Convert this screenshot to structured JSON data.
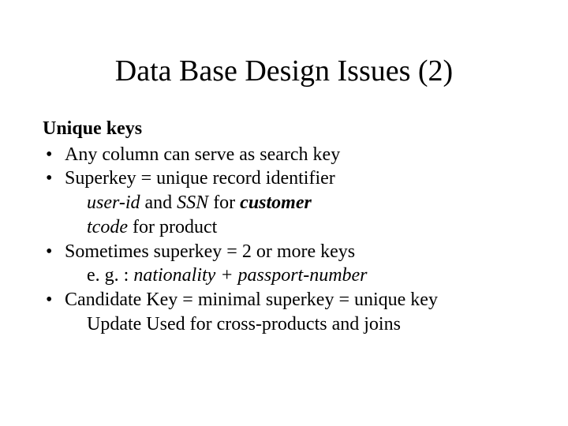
{
  "title": "Data Base Design Issues (2)",
  "section": "Unique keys",
  "items": [
    {
      "main": "Any column can serve as search key"
    },
    {
      "main": "Superkey = unique record identifier",
      "sub1_it1": "user-id",
      "sub1_txt1": " and ",
      "sub1_it2": "SSN",
      "sub1_txt2": " for ",
      "sub1_bi": "customer",
      "sub2_it": "tcode",
      "sub2_txt": " for product"
    },
    {
      "main": "Sometimes superkey = 2 or more keys",
      "sub1_txt1": "e. g. : ",
      "sub1_it1": "nationality + passport-number"
    },
    {
      "main": "Candidate Key = minimal superkey = unique key",
      "sub1_txt1": "Update Used for cross-products and joins"
    }
  ]
}
